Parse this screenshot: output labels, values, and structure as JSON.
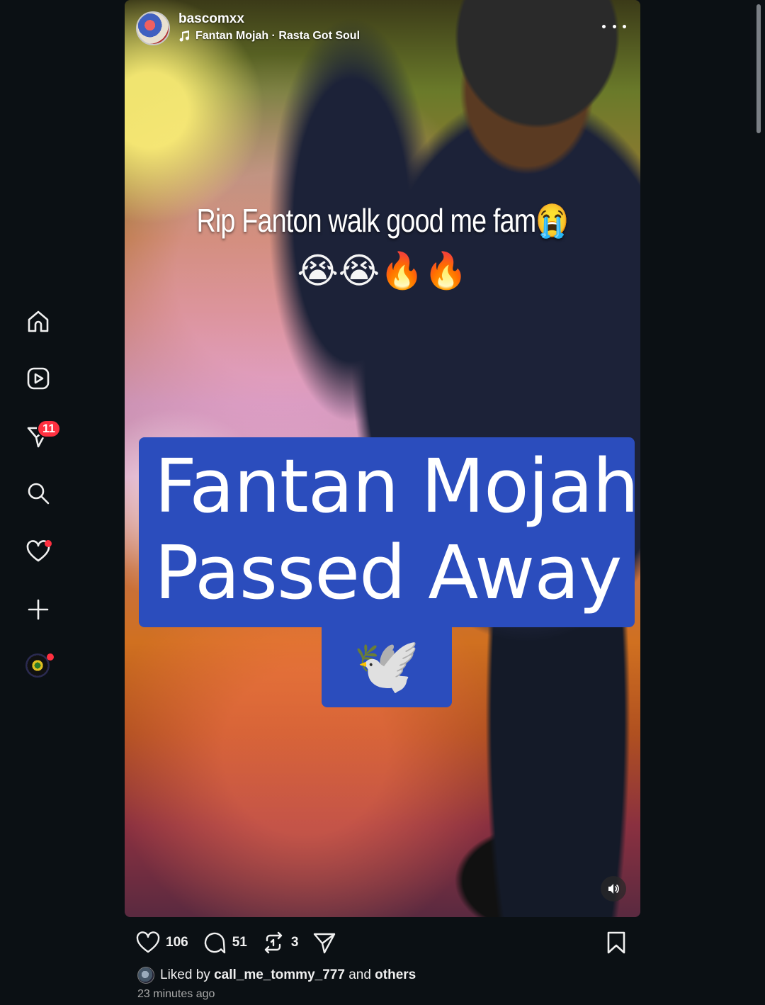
{
  "post": {
    "username": "bascomxx",
    "audio": "Fantan Mojah · Rasta Got Soul",
    "overlay_caption": "Rip Fanton  walk good me fam😭",
    "overlay_emojis": "😭😭🔥🔥",
    "headline_line1": "Fantan Mojah",
    "headline_line2": "Passed Away",
    "headline_emoji": "🕊️",
    "headline_color": "#2b4dbd"
  },
  "nav": {
    "messages_badge": "11",
    "icons": [
      "home-icon",
      "reels-icon",
      "messages-icon",
      "search-icon",
      "notifications-icon",
      "create-icon",
      "profile-avatar"
    ]
  },
  "actions": {
    "likes": "106",
    "comments": "51",
    "reposts": "3"
  },
  "liked_by": {
    "prefix": "Liked by",
    "user": "call_me_tommy_777",
    "middle": "and",
    "suffix": "others"
  },
  "timestamp": "23 minutes ago",
  "colors": {
    "badge": "#ff3040",
    "background": "#0b1014"
  }
}
